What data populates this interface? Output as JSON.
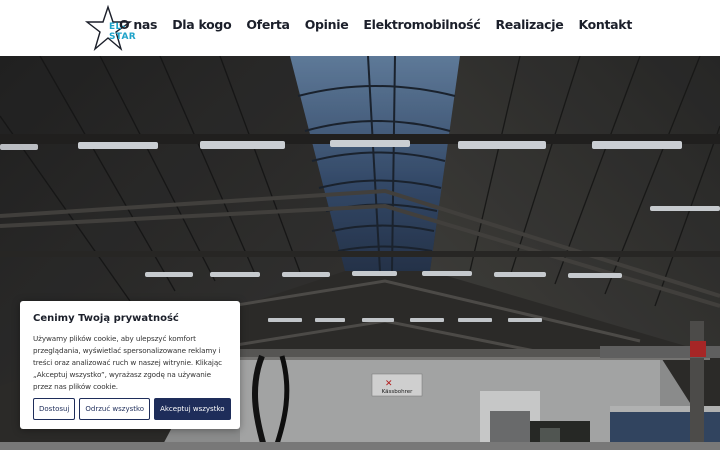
{
  "brand": {
    "logo_text": "EL-STAR",
    "accent_color": "#1fa3c9"
  },
  "nav": {
    "items": [
      {
        "label": "O nas"
      },
      {
        "label": "Dla kogo"
      },
      {
        "label": "Oferta"
      },
      {
        "label": "Opinie"
      },
      {
        "label": "Elektromobilność"
      },
      {
        "label": "Realizacje"
      },
      {
        "label": "Kontakt"
      }
    ]
  },
  "hero": {
    "sign_text": "Kässbohrer"
  },
  "cookie": {
    "title": "Cenimy Twoją prywatność",
    "text": "Używamy plików cookie, aby ulepszyć komfort przeglądania, wyświetlać spersonalizowane reklamy i treści oraz analizować ruch w naszej witrynie. Klikając „Akceptuj wszystko”, wyrażasz zgodę na używanie przez nas plików cookie.",
    "customize_label": "Dostosuj",
    "reject_label": "Odrzuć wszystko",
    "accept_label": "Akceptuj wszystko",
    "button_color": "#1e2d5a"
  }
}
